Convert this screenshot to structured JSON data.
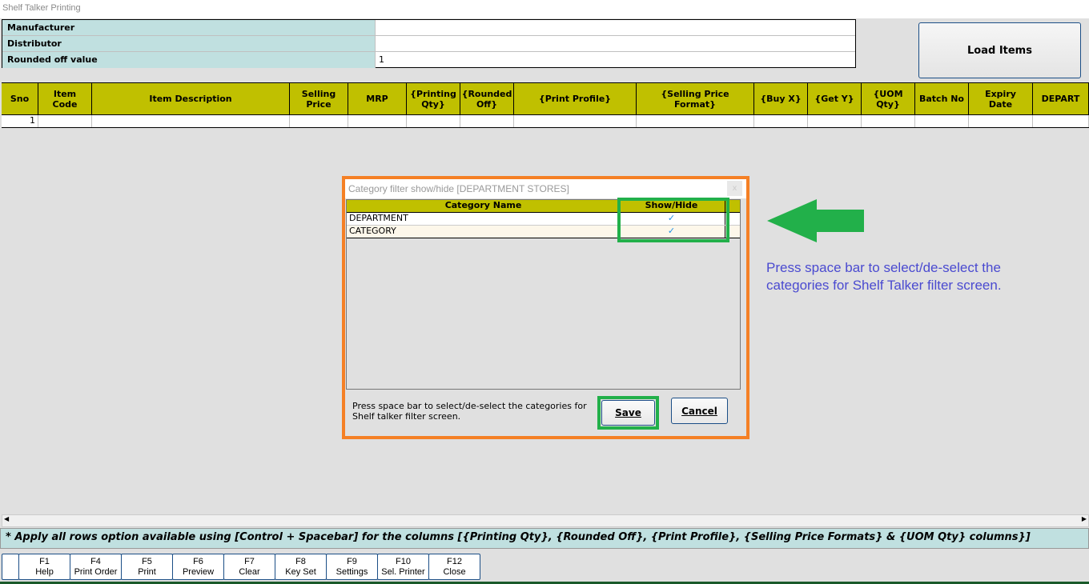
{
  "window": {
    "title": "Shelf Talker Printing"
  },
  "form": {
    "rows": [
      {
        "label": "Manufacturer",
        "value": ""
      },
      {
        "label": "Distributor",
        "value": ""
      },
      {
        "label": "Rounded off value",
        "value": "1"
      }
    ],
    "load_items_label": "Load Items"
  },
  "grid": {
    "columns": [
      "Sno",
      "Item\nCode",
      "Item Description",
      "Selling\nPrice",
      "MRP",
      "{Printing\nQty}",
      "{Rounded\nOff}",
      "{Print Profile}",
      "{Selling Price\nFormat}",
      "{Buy X}",
      "{Get Y}",
      "{UOM\nQty}",
      "Batch No",
      "Expiry\nDate",
      "DEPART"
    ],
    "rows": [
      [
        "1",
        "",
        "",
        "",
        "",
        "",
        "",
        "",
        "",
        "",
        "",
        "",
        "",
        "",
        ""
      ]
    ]
  },
  "note": "* Apply all rows option available using [Control + Spacebar] for the columns [{Printing Qty}, {Rounded Off}, {Print Profile}, {Selling Price Formats} & {UOM Qty} columns}]",
  "function_keys": [
    {
      "key": "F1",
      "label": "Help"
    },
    {
      "key": "F4",
      "label": "Print Order"
    },
    {
      "key": "F5",
      "label": "Print"
    },
    {
      "key": "F6",
      "label": "Preview"
    },
    {
      "key": "F7",
      "label": "Clear"
    },
    {
      "key": "F8",
      "label": "Key Set"
    },
    {
      "key": "F9",
      "label": "Settings"
    },
    {
      "key": "F10",
      "label": "Sel. Printer"
    },
    {
      "key": "F12",
      "label": "Close"
    }
  ],
  "dialog": {
    "title": "Category filter show/hide [DEPARTMENT STORES]",
    "close": "x",
    "headers": {
      "name": "Category Name",
      "show": "Show/Hide"
    },
    "rows": [
      {
        "name": "DEPARTMENT",
        "show": "✓"
      },
      {
        "name": "CATEGORY",
        "show": "✓"
      }
    ],
    "hint": "Press space bar to select/de-select the categories for Shelf talker filter screen.",
    "save_label": "Save",
    "cancel_label": "Cancel"
  },
  "annotation": {
    "text": "Press space bar to select/de-select the categories for Shelf Talker filter screen.",
    "arrow_color": "#22b04a",
    "highlight_color": "#22b04a",
    "dialog_border_color": "#f58025"
  }
}
